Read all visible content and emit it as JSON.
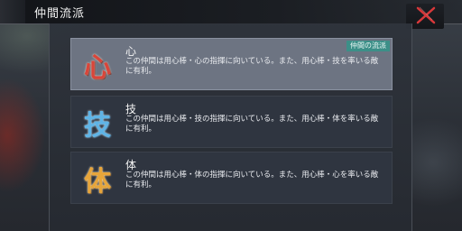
{
  "header": {
    "title": "仲間流派"
  },
  "cards": [
    {
      "emblem": "心",
      "name": "心",
      "description": "この仲間は用心棒・心の指揮に向いている。また、用心棒・技を率いる敵に有利。",
      "badge": "仲間の流派",
      "selected": true
    },
    {
      "emblem": "技",
      "name": "技",
      "description": "この仲間は用心棒・技の指揮に向いている。また、用心棒・体を率いる敵に有利。",
      "selected": false
    },
    {
      "emblem": "体",
      "name": "体",
      "description": "この仲間は用心棒・体の指揮に向いている。また、用心棒・心を率いる敵に有利。",
      "selected": false
    }
  ],
  "colors": {
    "badge": "#3c8f88",
    "close_icon": "#d8383a",
    "emblem_shin": "#d9453a",
    "emblem_gi": "#5fb4e6",
    "emblem_tai": "#e7a53a"
  },
  "icons": {
    "close": "close-x-icon"
  }
}
